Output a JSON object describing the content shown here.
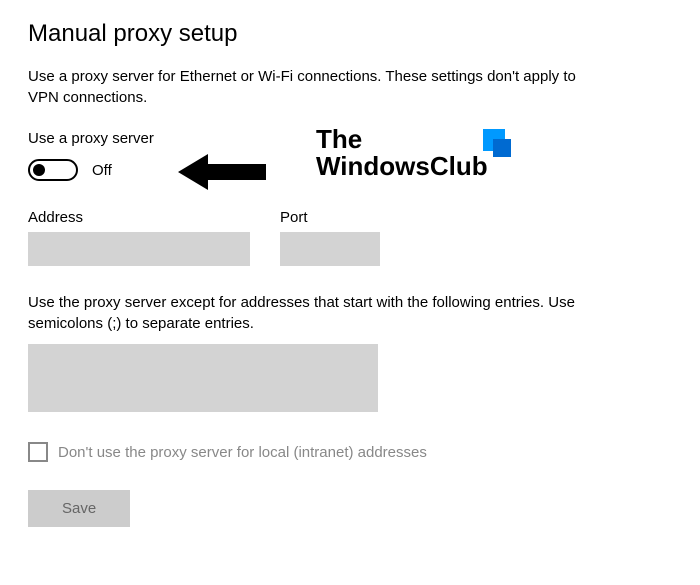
{
  "page_title": "Manual proxy setup",
  "description": "Use a proxy server for Ethernet or Wi-Fi connections. These settings don't apply to VPN connections.",
  "toggle": {
    "label": "Use a proxy server",
    "state": "Off"
  },
  "address": {
    "label": "Address",
    "value": ""
  },
  "port": {
    "label": "Port",
    "value": ""
  },
  "exceptions": {
    "description": "Use the proxy server except for addresses that start with the following entries. Use semicolons (;) to separate entries.",
    "value": ""
  },
  "local_bypass": {
    "checked": false,
    "label": "Don't use the proxy server for local (intranet) addresses"
  },
  "save_label": "Save",
  "watermark": {
    "line1": "The",
    "line2": "WindowsClub"
  }
}
